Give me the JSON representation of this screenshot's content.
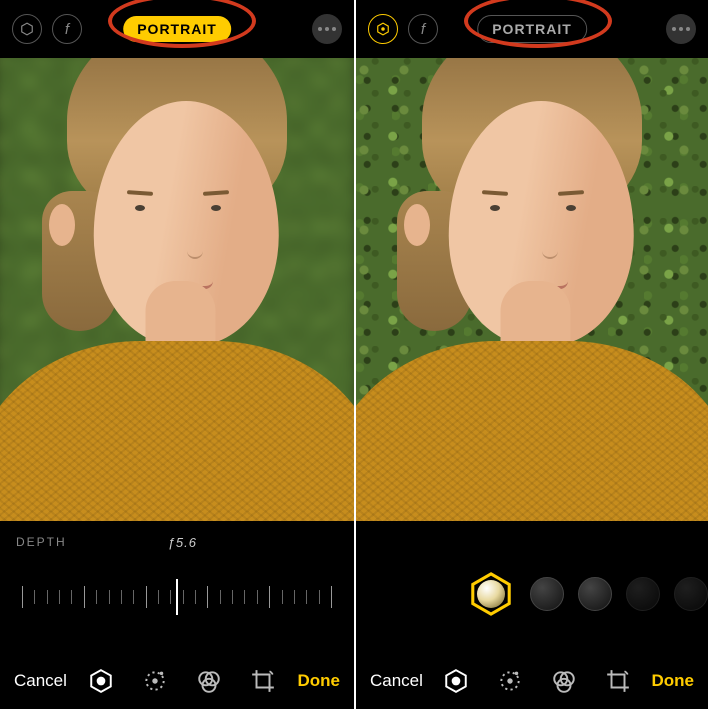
{
  "left": {
    "portrait_badge": "PORTRAIT",
    "portrait_active": true,
    "depth_label": "DEPTH",
    "depth_value": "ƒ5.6",
    "cancel": "Cancel",
    "done": "Done",
    "tools": [
      "portrait-lighting",
      "adjust",
      "filters",
      "crop"
    ],
    "selected_tool": "portrait-lighting"
  },
  "right": {
    "portrait_badge": "PORTRAIT",
    "portrait_active": false,
    "cancel": "Cancel",
    "done": "Done",
    "tools": [
      "portrait-lighting",
      "adjust",
      "filters",
      "crop"
    ],
    "selected_tool": "portrait-lighting",
    "lighting_options": [
      "natural",
      "studio",
      "contour",
      "stage"
    ]
  }
}
